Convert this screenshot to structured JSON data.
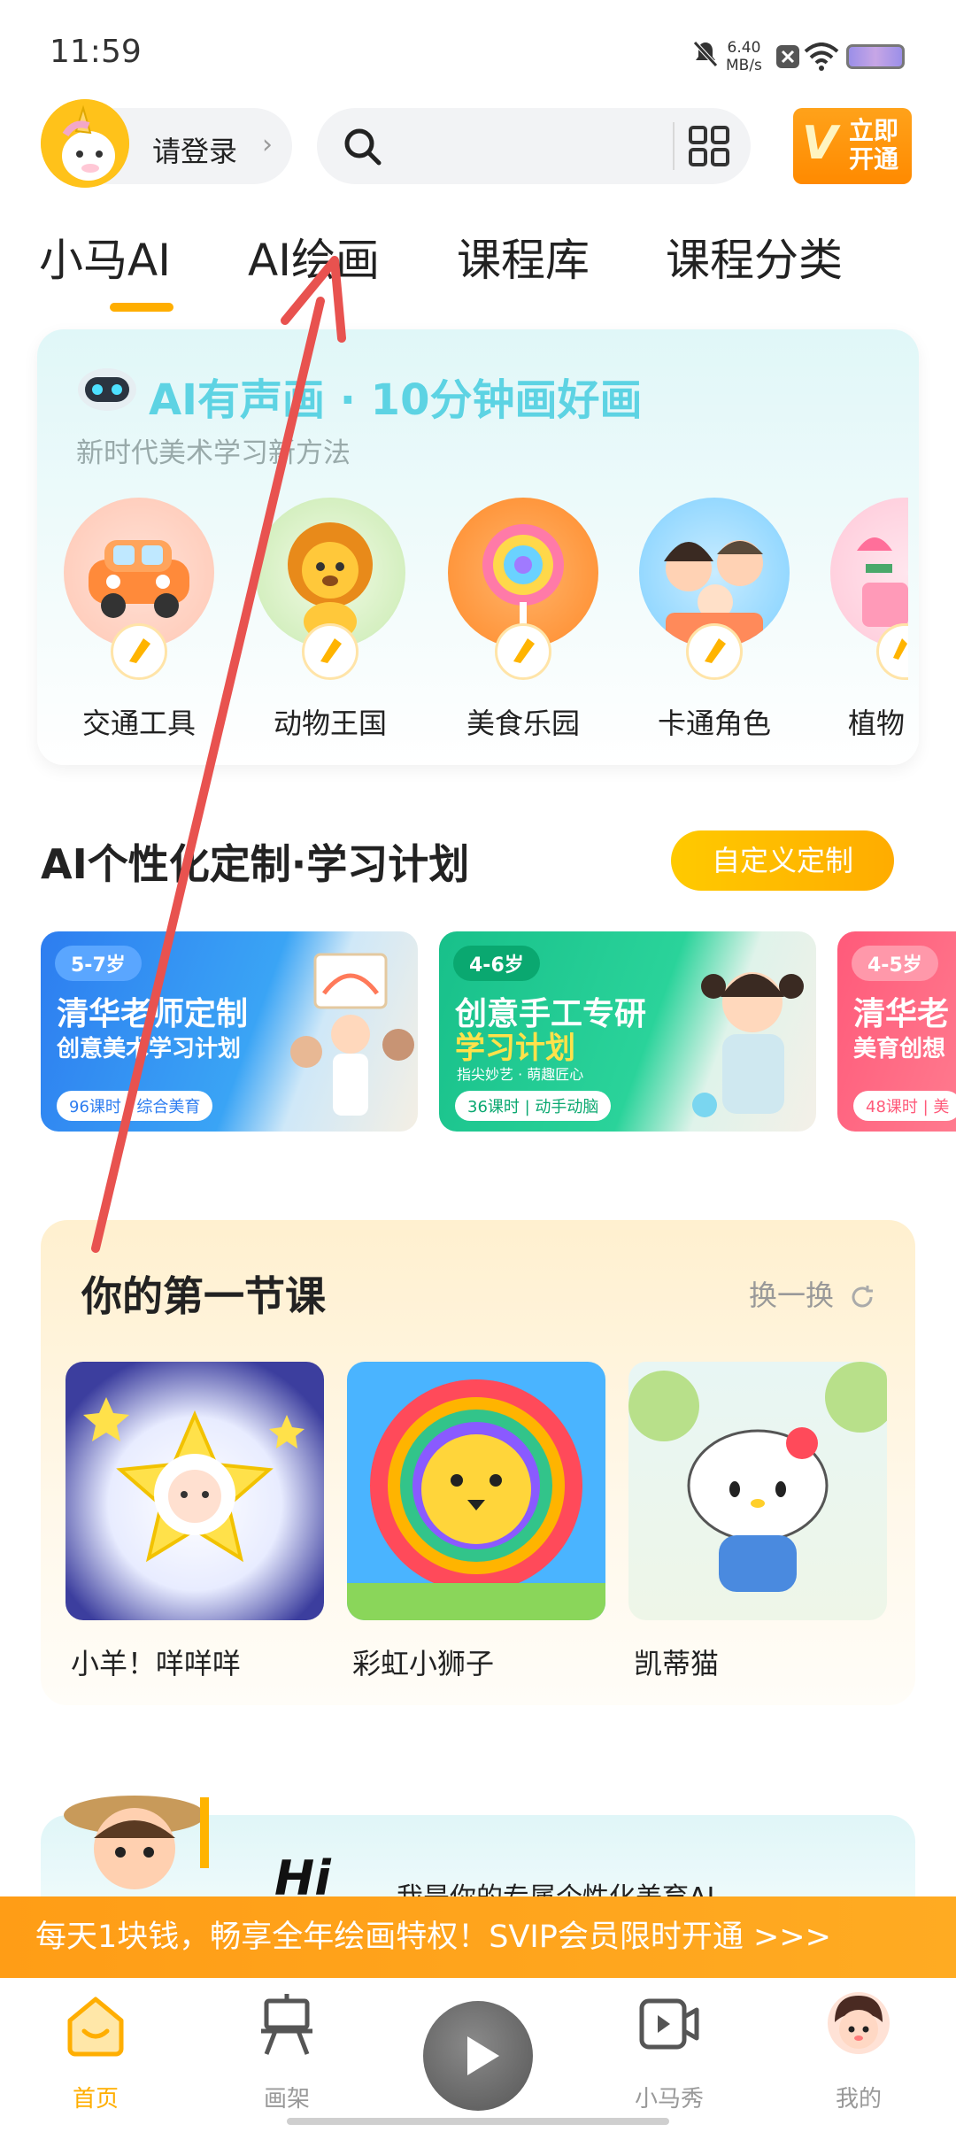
{
  "status_bar": {
    "time": "11:59",
    "net_speed_value": "6.40",
    "net_speed_unit": "MB/s",
    "icons": [
      "mute-icon",
      "notification-x-icon",
      "wifi-icon",
      "battery-icon"
    ]
  },
  "header": {
    "login_label": "请登录",
    "chevron": "›",
    "search_placeholder": "",
    "vip_badge": "V",
    "vip_label": "立即开通"
  },
  "tabs": [
    {
      "label": "小马AI",
      "active": true
    },
    {
      "label": "AI绘画",
      "active": false
    },
    {
      "label": "课程库",
      "active": false
    },
    {
      "label": "课程分类",
      "active": false
    }
  ],
  "ai_card": {
    "title": "AI有声画 · 10分钟画好画",
    "subtitle": "新时代美术学习新方法",
    "categories": [
      {
        "label": "交通工具"
      },
      {
        "label": "动物王国"
      },
      {
        "label": "美食乐园"
      },
      {
        "label": "卡通角色"
      },
      {
        "label": "植物"
      }
    ]
  },
  "plan": {
    "title": "AI个性化定制·学习计划",
    "custom_button": "自定义定制",
    "cards": [
      {
        "age": "5-7岁",
        "line1": "清华老师定制",
        "line2": "创意美术学习计划",
        "line3": "",
        "tag": "96课时 | 综合美育"
      },
      {
        "age": "4-6岁",
        "line1": "创意手工专研",
        "line2": "学习计划",
        "line3": "指尖妙艺 · 萌趣匠心",
        "tag": "36课时 | 动手动脑"
      },
      {
        "age": "4-5岁",
        "line1": "清华老",
        "line2": "美育创想",
        "line3": "",
        "tag": "48课时 | 美"
      }
    ]
  },
  "first_lesson": {
    "title": "你的第一节课",
    "refresh_label": "换一换",
    "lessons": [
      {
        "label": "小羊！咩咩咩"
      },
      {
        "label": "彩虹小狮子"
      },
      {
        "label": "凯蒂猫"
      }
    ]
  },
  "hi_banner": {
    "hi": "Hi",
    "text": "我是你的专属个性化美育AI"
  },
  "promo": {
    "text": "每天1块钱，畅享全年绘画特权！SVIP会员限时开通 >>>"
  },
  "bottom_nav": [
    {
      "label": "首页",
      "active": true
    },
    {
      "label": "画架",
      "active": false
    },
    {
      "label": "",
      "active": false
    },
    {
      "label": "小马秀",
      "active": false
    },
    {
      "label": "我的",
      "active": false
    }
  ],
  "colors": {
    "accent": "#ffae00",
    "promo": "#ff9d16",
    "annotation_arrow": "#e8524f",
    "ai_title": "#5dd3e3"
  }
}
